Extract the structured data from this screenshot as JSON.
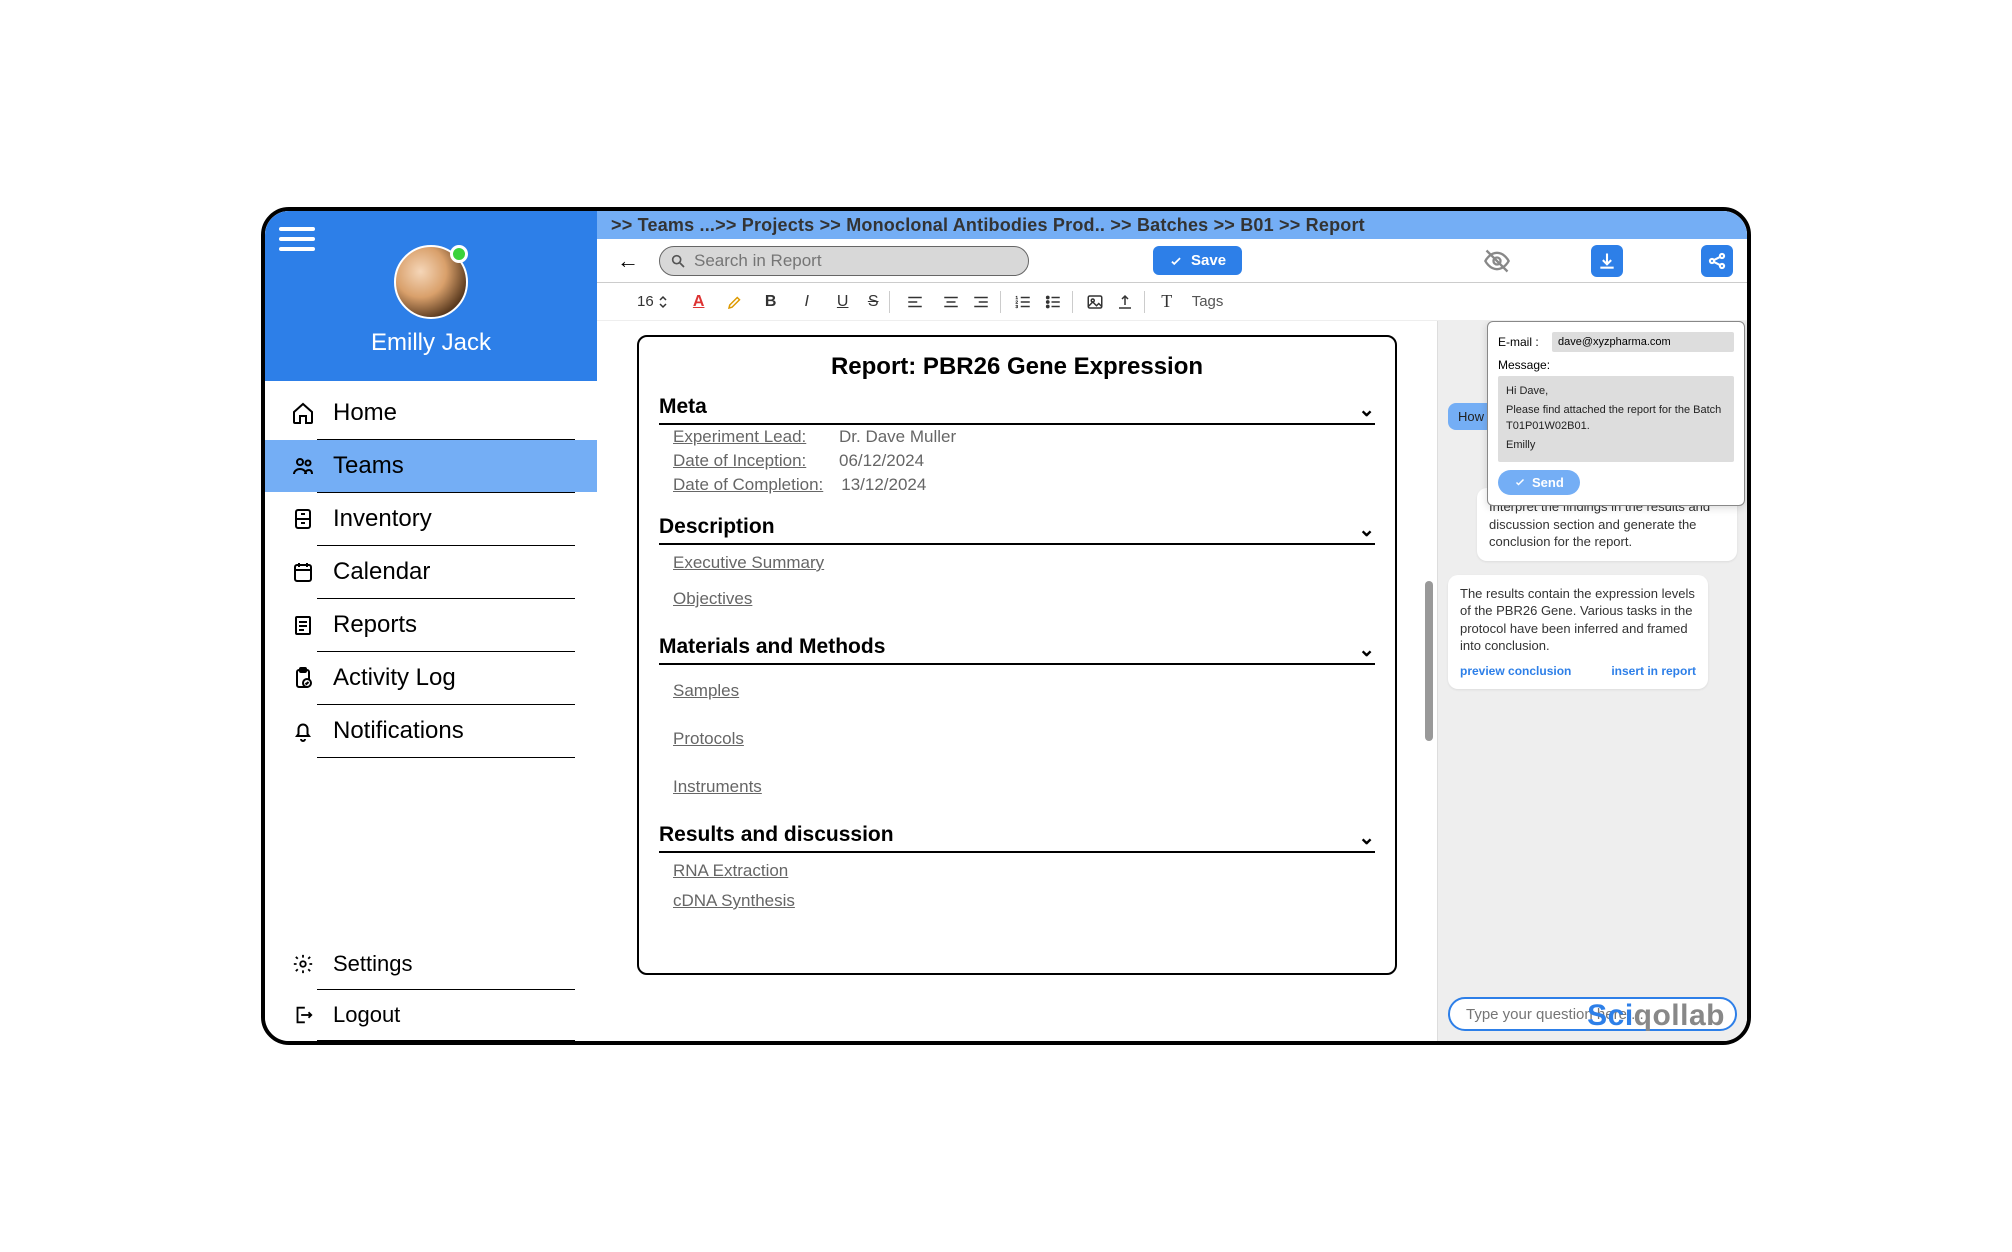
{
  "user": {
    "name": "Emilly Jack"
  },
  "sidebar": {
    "items": [
      {
        "label": "Home",
        "icon": "home-icon"
      },
      {
        "label": "Teams",
        "icon": "users-icon",
        "active": true
      },
      {
        "label": "Inventory",
        "icon": "cabinet-icon"
      },
      {
        "label": "Calendar",
        "icon": "calendar-icon"
      },
      {
        "label": "Reports",
        "icon": "reports-icon"
      },
      {
        "label": "Activity Log",
        "icon": "clipboard-icon"
      },
      {
        "label": "Notifications",
        "icon": "bell-icon"
      }
    ],
    "bottom": [
      {
        "label": "Settings",
        "icon": "gear-icon"
      },
      {
        "label": "Logout",
        "icon": "logout-icon"
      }
    ]
  },
  "breadcrumb": ">> Teams ...>> Projects >> Monoclonal Antibodies Prod.. >> Batches >> B01 >> Report",
  "toolbar": {
    "search_placeholder": "Search in Report",
    "save_label": "Save"
  },
  "format": {
    "font_size": "16",
    "tags_label": "Tags"
  },
  "report": {
    "title": "Report: PBR26 Gene Expression",
    "sections": {
      "meta": {
        "heading": "Meta",
        "rows": [
          {
            "label": "Experiment Lead:",
            "value": "Dr. Dave Muller"
          },
          {
            "label": "Date of Inception:",
            "value": "06/12/2024"
          },
          {
            "label": "Date of Completion:",
            "value": "13/12/2024"
          }
        ]
      },
      "description": {
        "heading": "Description",
        "items": [
          "Executive Summary",
          "Objectives"
        ]
      },
      "materials": {
        "heading": "Materials and Methods",
        "items": [
          "Samples",
          "Protocols",
          "Instruments"
        ]
      },
      "results": {
        "heading": "Results and discussion",
        "items": [
          "RNA Extraction",
          "cDNA Synthesis"
        ]
      }
    }
  },
  "share": {
    "email_label": "E-mail :",
    "email_value": "dave@xyzpharma.com",
    "message_label": "Message:",
    "message_lines": [
      "Hi Dave,",
      "Please find attached the report for the Batch T01P01W02B01.",
      "Emilly"
    ],
    "send_label": "Send"
  },
  "chat": {
    "partial_top": "How c",
    "user_msg": "Interpret the findings in the results and discussion section and generate the conclusion for the report.",
    "assistant_msg": "The results contain the expression levels of the PBR26 Gene. Various tasks in the protocol have been inferred and framed into conclusion.",
    "link_preview": "preview conclusion",
    "link_insert": "insert in report",
    "input_placeholder": "Type your question here ..."
  },
  "brand": {
    "part1": "Sci",
    "part2": "qollab"
  }
}
